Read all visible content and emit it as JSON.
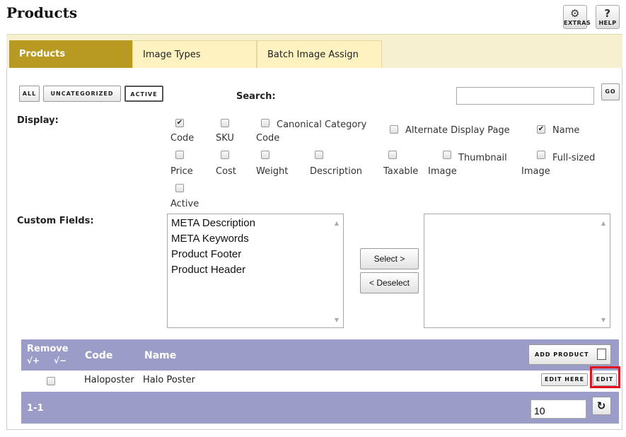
{
  "page": {
    "title": "Products",
    "extras_label": "EXTRAS",
    "help_label": "HELP"
  },
  "tabs": [
    {
      "label": "Products",
      "active": true
    },
    {
      "label": "Image Types",
      "active": false
    },
    {
      "label": "Batch Image Assign",
      "active": false
    }
  ],
  "filters": {
    "all": "ALL",
    "uncategorized": "UNCATEGORIZED",
    "active": "ACTIVE",
    "selected": "ACTIVE"
  },
  "search": {
    "label": "Search:",
    "value": "",
    "go_label": "GO"
  },
  "display": {
    "label": "Display:",
    "options": [
      {
        "line1": "",
        "line2": "Code",
        "checked": true
      },
      {
        "line1": "",
        "line2": "SKU",
        "checked": false
      },
      {
        "line1": "Canonical Category",
        "line2": "Code",
        "checked": false
      },
      {
        "line1": "Alternate Display Page",
        "line2": "",
        "checked": false
      },
      {
        "line1": "Name",
        "line2": "",
        "checked": true
      },
      {
        "line1": "",
        "line2": "Price",
        "checked": false
      },
      {
        "line1": "",
        "line2": "Cost",
        "checked": false
      },
      {
        "line1": "",
        "line2": "Weight",
        "checked": false
      },
      {
        "line1": "",
        "line2": "Description",
        "checked": false
      },
      {
        "line1": "",
        "line2": "Taxable",
        "checked": false
      },
      {
        "line1": "Thumbnail",
        "line2": "Image",
        "checked": false
      },
      {
        "line1": "Full-sized",
        "line2": "Image",
        "checked": false
      },
      {
        "line1": "",
        "line2": "Active",
        "checked": false
      }
    ]
  },
  "custom_fields": {
    "label": "Custom Fields:",
    "available": [
      "META Description",
      "META Keywords",
      "Product Footer",
      "Product Header"
    ],
    "selected": [],
    "select_label": "Select >",
    "deselect_label": "< Deselect"
  },
  "grid": {
    "remove_label": "Remove",
    "check_plus": "√+",
    "check_minus": "√−",
    "code_header": "Code",
    "name_header": "Name",
    "add_product_label": "ADD PRODUCT",
    "rows": [
      {
        "code": "Haloposter",
        "name": "Halo Poster",
        "edit_here_label": "EDIT HERE",
        "edit_label": "EDIT",
        "checked": false
      }
    ],
    "range": "1-1",
    "page_size": "10"
  },
  "colors": {
    "tab_active": "#b89a22",
    "tab_bar": "#f6efd0",
    "grid_header": "#9c9cc9",
    "highlight": "#e01020"
  }
}
